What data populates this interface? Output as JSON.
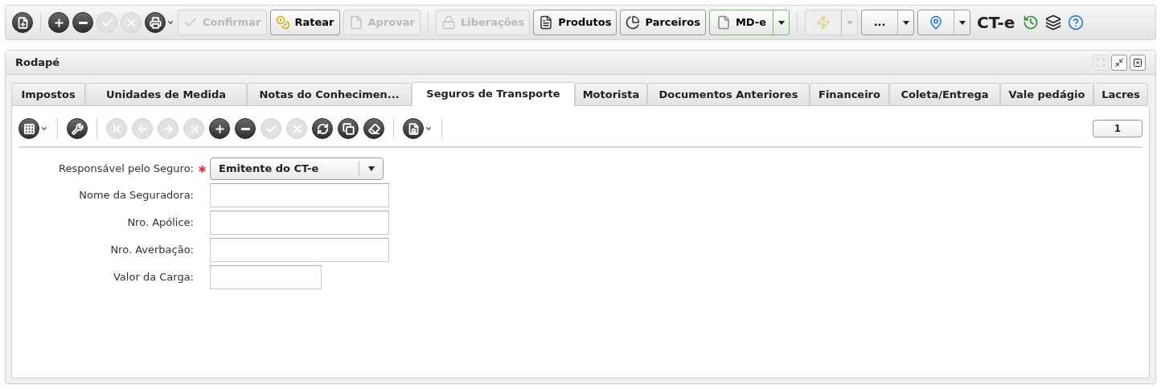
{
  "toolbar": {
    "items": [
      {
        "kind": "icon",
        "disabled": false,
        "dropdown": false
      },
      {
        "kind": "separator"
      },
      {
        "kind": "icon",
        "disabled": false,
        "dropdown": false
      },
      {
        "kind": "icon",
        "disabled": false,
        "dropdown": false
      },
      {
        "kind": "icon",
        "disabled": true,
        "dropdown": false
      },
      {
        "kind": "icon",
        "disabled": true,
        "dropdown": false
      },
      {
        "kind": "icon",
        "disabled": false,
        "dropdown": true
      },
      {
        "kind": "button",
        "label": "Confirmar",
        "disabled": true
      },
      {
        "kind": "button",
        "label": "Ratear",
        "disabled": false
      },
      {
        "kind": "button",
        "label": "Aprovar",
        "disabled": true
      },
      {
        "kind": "separator"
      },
      {
        "kind": "button",
        "label": "Liberações",
        "disabled": true
      },
      {
        "kind": "button",
        "label": "Produtos",
        "disabled": false
      },
      {
        "kind": "button",
        "label": "Parceiros",
        "disabled": false
      },
      {
        "kind": "split",
        "label": "MD-e",
        "disabled": false,
        "highlighted": true
      },
      {
        "kind": "separator"
      },
      {
        "kind": "split",
        "disabled": true,
        "highlighted": false
      },
      {
        "kind": "split",
        "label": "...",
        "disabled": false,
        "highlighted": false
      },
      {
        "kind": "split",
        "disabled": false,
        "highlighted": false
      },
      {
        "kind": "title",
        "label": "CT-e"
      },
      {
        "kind": "plain"
      },
      {
        "kind": "plain"
      },
      {
        "kind": "plain"
      }
    ]
  },
  "panel": {
    "title": "Rodapé",
    "window_buttons": [
      {
        "disabled": true
      },
      {
        "disabled": false
      },
      {
        "disabled": false
      }
    ],
    "tabs": [
      {
        "label": "Impostos",
        "selected": false
      },
      {
        "label": "Unidades de Medida",
        "selected": false
      },
      {
        "label": "Notas do Conhecimen...",
        "selected": false
      },
      {
        "label": "Seguros de Transporte",
        "selected": true
      },
      {
        "label": "Motorista",
        "selected": false
      },
      {
        "label": "Documentos Anteriores",
        "selected": false
      },
      {
        "label": "Financeiro",
        "selected": false
      },
      {
        "label": "Coleta/Entrega",
        "selected": false
      },
      {
        "label": "Vale pedágio",
        "selected": false
      },
      {
        "label": "Lacres",
        "selected": false
      }
    ],
    "toolbar": {
      "items": [
        {
          "kind": "icon",
          "disabled": false,
          "dropdown": true
        },
        {
          "kind": "separator"
        },
        {
          "kind": "icon",
          "disabled": false,
          "dropdown": false
        },
        {
          "kind": "separator"
        },
        {
          "kind": "icon",
          "disabled": true,
          "dropdown": false
        },
        {
          "kind": "icon",
          "disabled": true,
          "dropdown": false
        },
        {
          "kind": "icon",
          "disabled": true,
          "dropdown": false
        },
        {
          "kind": "icon",
          "disabled": true,
          "dropdown": false
        },
        {
          "kind": "icon",
          "disabled": false,
          "dropdown": false
        },
        {
          "kind": "icon",
          "disabled": false,
          "dropdown": false
        },
        {
          "kind": "icon",
          "disabled": true,
          "dropdown": false
        },
        {
          "kind": "icon",
          "disabled": true,
          "dropdown": false
        },
        {
          "kind": "icon",
          "disabled": false,
          "dropdown": false
        },
        {
          "kind": "icon",
          "disabled": false,
          "dropdown": false
        },
        {
          "kind": "icon",
          "disabled": false,
          "dropdown": false
        },
        {
          "kind": "separator"
        },
        {
          "kind": "icon",
          "disabled": false,
          "dropdown": true
        },
        {
          "kind": "separator"
        }
      ]
    },
    "page": "1",
    "form": [
      {
        "label": "Responsável pelo Seguro:",
        "required": true,
        "kind": "select",
        "value": "Emitente do CT-e"
      },
      {
        "label": "Nome da Seguradora:",
        "required": false,
        "kind": "text"
      },
      {
        "label": "Nro. Apólice:",
        "required": false,
        "kind": "text"
      },
      {
        "label": "Nro. Averbação:",
        "required": false,
        "kind": "text"
      },
      {
        "label": "Valor da Carga:",
        "required": false,
        "kind": "number"
      }
    ]
  }
}
